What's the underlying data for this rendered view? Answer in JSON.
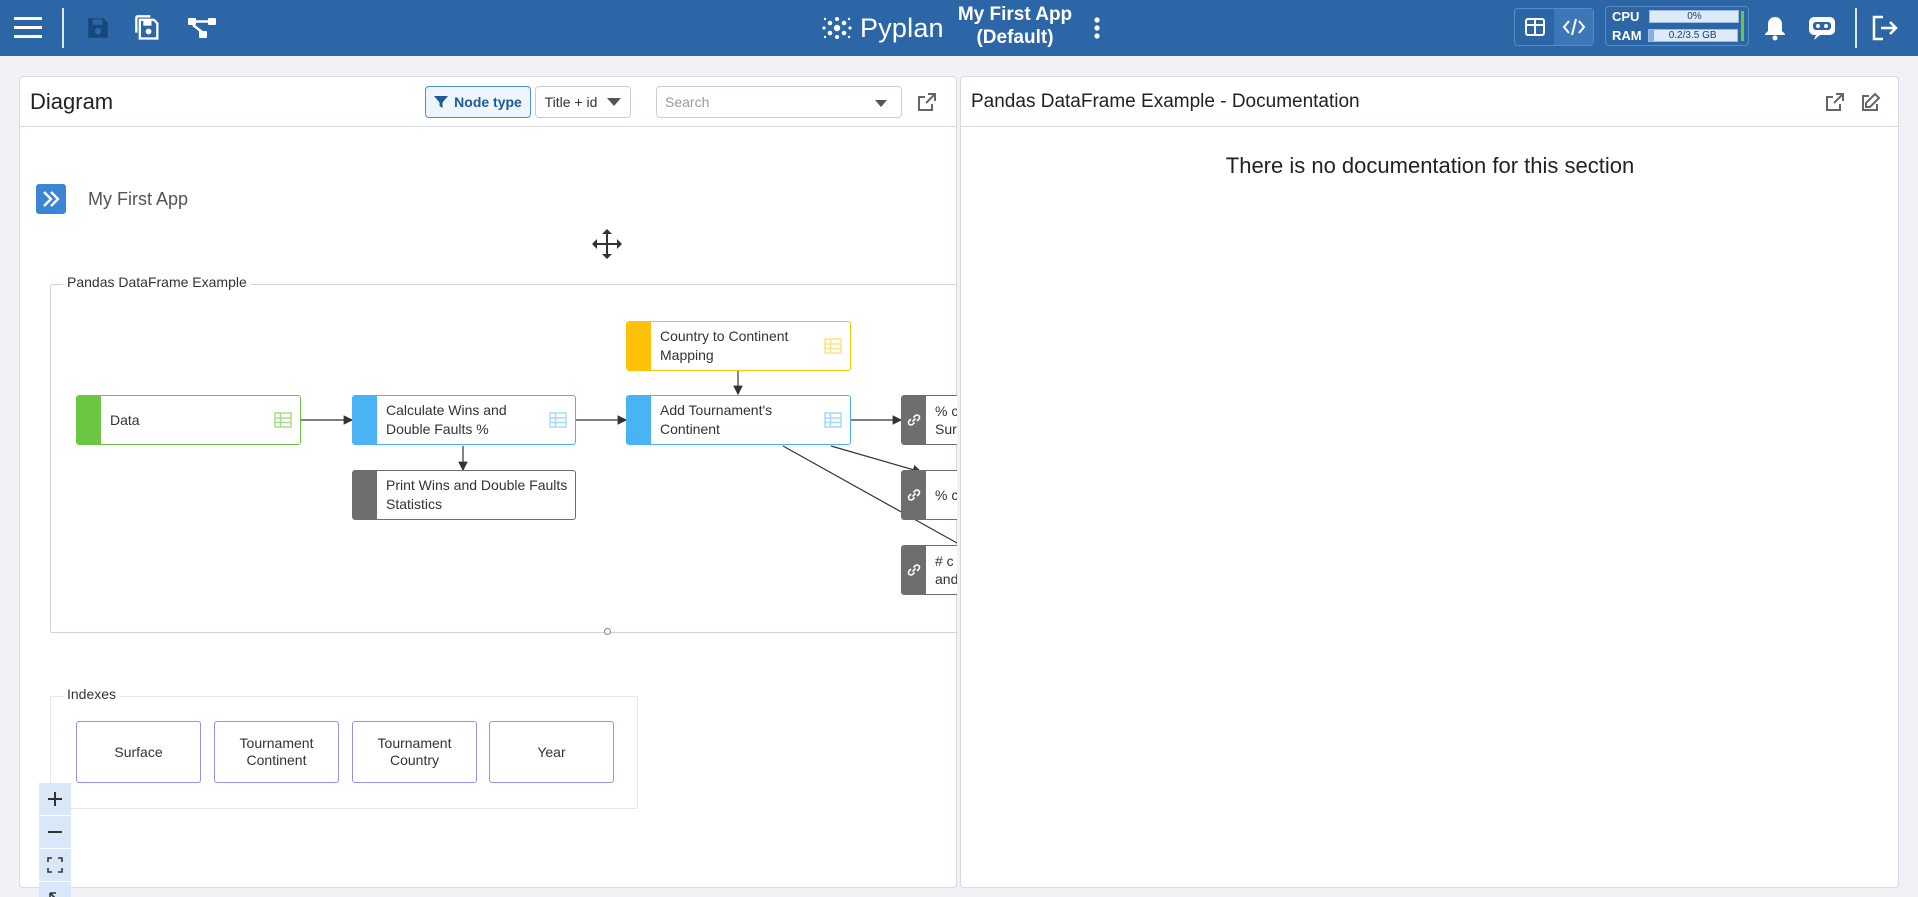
{
  "topbar": {
    "brand": "Pyplan",
    "app_title_line1": "My First App",
    "app_title_line2": "(Default)",
    "cpu_label": "CPU",
    "cpu_value": "0%",
    "cpu_fraction": 0.0,
    "ram_label": "RAM",
    "ram_value": "0.2/3.5 GB",
    "ram_fraction": 0.06,
    "colors": {
      "bar": "#2d66a6",
      "accent": "#3a86d4"
    }
  },
  "diagram": {
    "title": "Diagram",
    "node_type_label": "Node type",
    "title_mode_label": "Title + id",
    "search_placeholder": "Search",
    "breadcrumb": "My First App",
    "group_main": "Pandas DataFrame Example",
    "group_indexes": "Indexes",
    "nodes": {
      "data": "Data",
      "calc_wins": "Calculate Wins and Double Faults %",
      "print_wins": "Print Wins and Double Faults Statistics",
      "country_map": "Country to Continent Mapping",
      "add_continent": "Add Tournament's Continent",
      "pct_sur_line1": "% c",
      "pct_sur_line2": "Sur",
      "pct_c": "% c",
      "count_line1": "# c",
      "count_line2": "and"
    },
    "indexes": [
      "Surface",
      "Tournament Continent",
      "Tournament Country",
      "Year"
    ],
    "node_colors": {
      "data": "#6cc644",
      "variable": "#4ab3f4",
      "input": "#ffc107",
      "report": "#6e6e6e",
      "index_border": "#9b8ff0"
    }
  },
  "documentation": {
    "title": "Pandas DataFrame Example - Documentation",
    "empty_message": "There is no documentation for this section"
  }
}
